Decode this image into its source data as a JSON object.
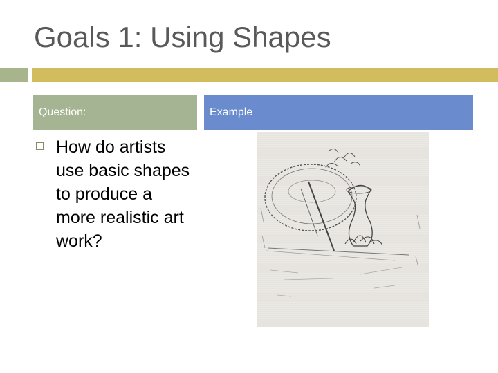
{
  "slide": {
    "title": "Goals 1: Using Shapes",
    "left_header": "Question:",
    "right_header": "Example",
    "bullet_text": "How do artists use basic shapes to produce a more realistic art work?"
  },
  "colors": {
    "title_text": "#595959",
    "rule_left": "#a7b48c",
    "rule_right": "#d2bd5e",
    "question_header_bg": "#a5b492",
    "example_header_bg": "#6a8bcd"
  },
  "image": {
    "description_icon": "pencil-sketch-still-life"
  }
}
